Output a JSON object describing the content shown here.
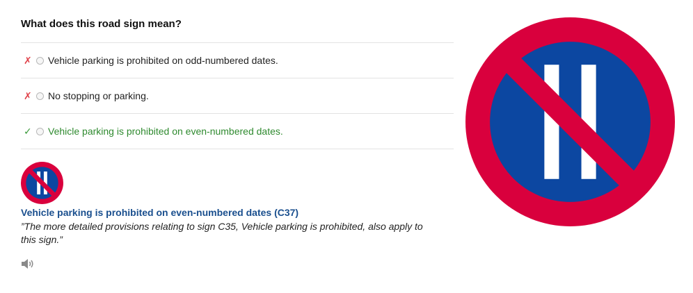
{
  "question": "What does this road sign mean?",
  "options": [
    {
      "label": "Vehicle parking is prohibited on odd-numbered dates.",
      "status": "wrong",
      "mark": "✗"
    },
    {
      "label": "No stopping or parking.",
      "status": "wrong",
      "mark": "✗"
    },
    {
      "label": "Vehicle parking is prohibited on even-numbered dates.",
      "status": "correct",
      "mark": "✓"
    }
  ],
  "explanation": {
    "title": "Vehicle parking is prohibited on even-numbered dates (C37)",
    "description": "”The more detailed provisions relating to sign C35, Vehicle parking is prohibited, also apply to this sign.”"
  },
  "icons": {
    "audio": "speaker-icon",
    "sign": "no-parking-even-dates-sign"
  },
  "colors": {
    "sign_red": "#d9003d",
    "sign_blue": "#0c47a1",
    "wrong": "#e0424a",
    "correct": "#2f8a2f",
    "title_blue": "#1a4f8e"
  }
}
